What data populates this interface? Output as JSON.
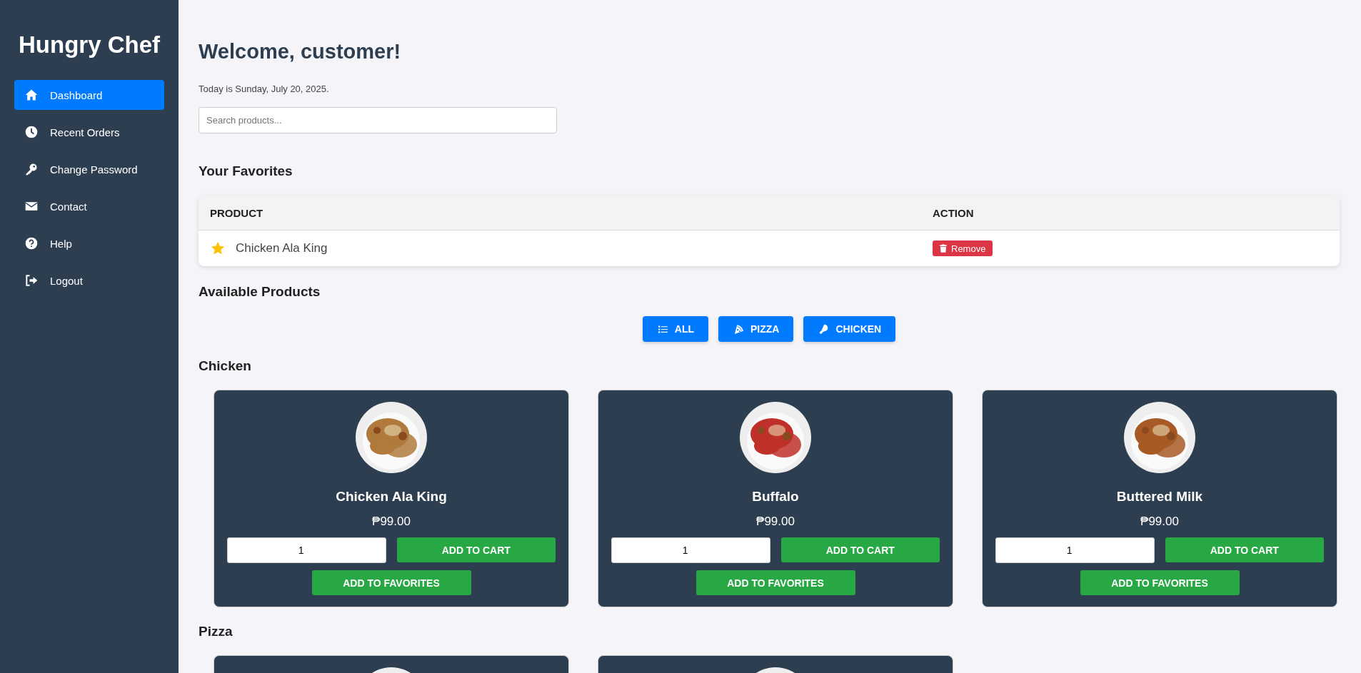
{
  "sidebar": {
    "title": "Hungry Chef",
    "items": [
      {
        "label": "Dashboard",
        "selected": true
      },
      {
        "label": "Recent Orders",
        "selected": false
      },
      {
        "label": "Change Password",
        "selected": false
      },
      {
        "label": "Contact",
        "selected": false
      },
      {
        "label": "Help",
        "selected": false
      },
      {
        "label": "Logout",
        "selected": false
      }
    ]
  },
  "header": {
    "title": "Welcome, customer!",
    "date": "Today is Sunday, July 20, 2025."
  },
  "search": {
    "placeholder": "Search products..."
  },
  "favorites": {
    "title": "Your Favorites",
    "columns": [
      "PRODUCT",
      "ACTION"
    ],
    "rows": [
      {
        "product": "Chicken Ala King",
        "action": "Remove"
      }
    ]
  },
  "products": {
    "title": "Available Products",
    "filters": [
      {
        "label": "ALL"
      },
      {
        "label": "PIZZA"
      },
      {
        "label": "CHICKEN"
      }
    ],
    "sections": [
      {
        "title": "Chicken",
        "items": [
          {
            "kind": "card",
            "name": "Chicken Ala King",
            "price": "₱99.00",
            "quantity": "1",
            "cart": "ADD TO CART",
            "favorite": "ADD TO FAVORITES"
          },
          {
            "kind": "card",
            "name": "Buffalo",
            "price": "₱99.00",
            "quantity": "1",
            "cart": "ADD TO CART",
            "favorite": "ADD TO FAVORITES"
          },
          {
            "kind": "card",
            "name": "Buttered Milk",
            "price": "₱99.00",
            "quantity": "1",
            "cart": "ADD TO CART",
            "favorite": "ADD TO FAVORITES"
          }
        ]
      },
      {
        "title": "Pizza"
      }
    ]
  }
}
